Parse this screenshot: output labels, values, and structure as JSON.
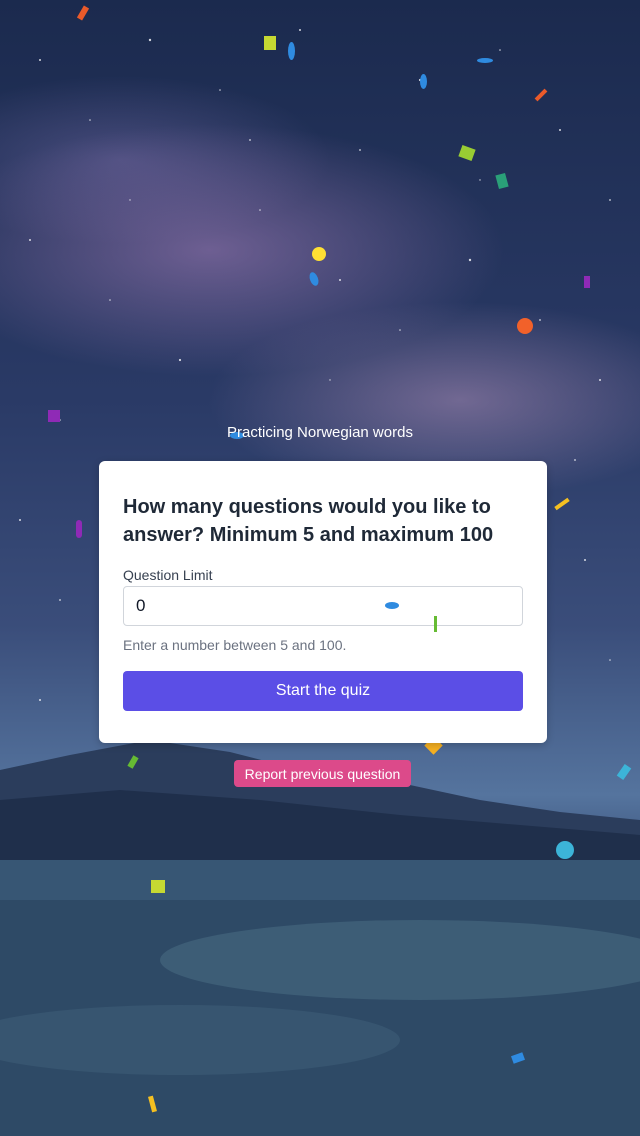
{
  "header": {
    "subtitle": "Practicing Norwegian words"
  },
  "card": {
    "title": "How many questions would you like to answer? Minimum 5 and maximum 100",
    "field_label": "Question Limit",
    "input_value": "0",
    "hint": "Enter a number between 5 and 100.",
    "start_button": "Start the quiz"
  },
  "report_button": "Report previous question",
  "colors": {
    "primary": "#5b4ee6",
    "report": "#dc4a8a"
  }
}
